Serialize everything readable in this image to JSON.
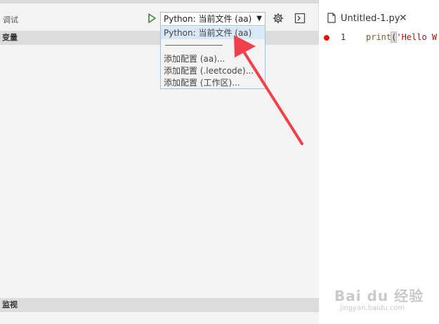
{
  "debug": {
    "title": "调试",
    "config_value": "Python: 当前文件 (aa)",
    "run_icon": "play-icon",
    "settings_icon": "gear-icon",
    "console_icon": "debug-console-icon"
  },
  "dropdown": {
    "options": [
      "Python: 当前文件 (aa)",
      "─────────",
      "添加配置 (aa)...",
      "添加配置 (.leetcode)...",
      "添加配置 (工作区)..."
    ],
    "selected_index": 0
  },
  "sections": {
    "variables": "变量",
    "watch": "监视"
  },
  "editor": {
    "tab_label": "Untitled-1.py",
    "tab_icon": "file-icon",
    "close_icon": "close-icon",
    "line_number": "1",
    "code_fn": "print",
    "code_open": "(",
    "code_str": "'Hello W",
    "breakpoint_color": "#e51400"
  },
  "watermark": {
    "logo": "Bai du 经验",
    "url": "jingyan.baidu.com"
  },
  "colors": {
    "annotation_arrow": "#f2404a",
    "dropdown_border": "#9cc4e4",
    "selected_option": "#d8e8f7"
  }
}
